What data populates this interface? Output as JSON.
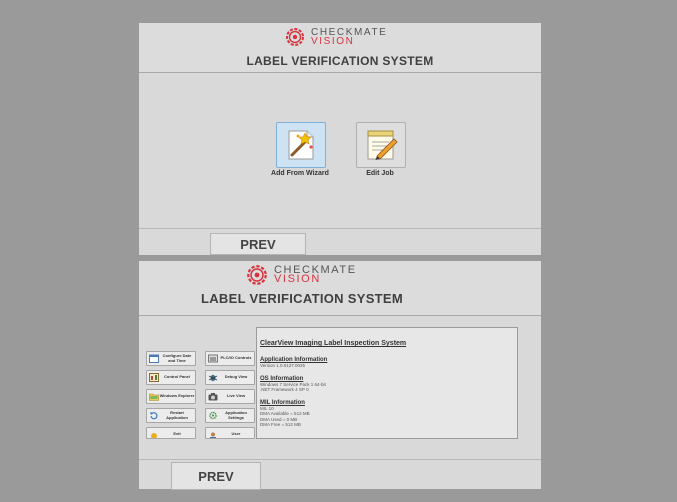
{
  "brand": {
    "line1": "CHECKMATE",
    "line2": "VISION",
    "accent": "#d9333f"
  },
  "system_title": "LABEL VERIFICATION SYSTEM",
  "top": {
    "actions": [
      {
        "label": "Add From Wizard",
        "icon": "wizard-wand-icon"
      },
      {
        "label": "Edit Job",
        "icon": "notepad-pencil-icon"
      }
    ],
    "prev_label": "PREV"
  },
  "bottom": {
    "tiles": [
      {
        "label": "Configure Date and Time",
        "icon": "datetime-icon"
      },
      {
        "label": "PLC/IO Controls",
        "icon": "plc-io-icon"
      },
      {
        "label": "Control Panel",
        "icon": "control-panel-icon"
      },
      {
        "label": "Debug View",
        "icon": "debug-bug-icon"
      },
      {
        "label": "Windows Explorer",
        "icon": "folder-icon"
      },
      {
        "label": "Live View",
        "icon": "camera-icon"
      },
      {
        "label": "Restart Application",
        "icon": "restart-icon"
      },
      {
        "label": "Application Settings",
        "icon": "settings-icon"
      },
      {
        "label": "Exit",
        "icon": "exit-icon"
      },
      {
        "label": "User",
        "icon": "user-icon"
      }
    ],
    "info": {
      "heading": "ClearView Imaging Label Inspection System",
      "app_title": "Application Information",
      "app_version": "Version 1.0.0127.0025",
      "os_title": "OS Information",
      "os_line1": "Windows 7 Service Pack 1 64-bit",
      "os_line2": ".NET Framework 4 SP 0",
      "mil_title": "MIL Information",
      "mil_line1": "MIL 10",
      "mil_line2": "DMA Available = 512 MB",
      "mil_line3": "DMA Used = 0 MB",
      "mil_line4": "DMA Free = 512 MB"
    },
    "prev_label": "PREV"
  }
}
